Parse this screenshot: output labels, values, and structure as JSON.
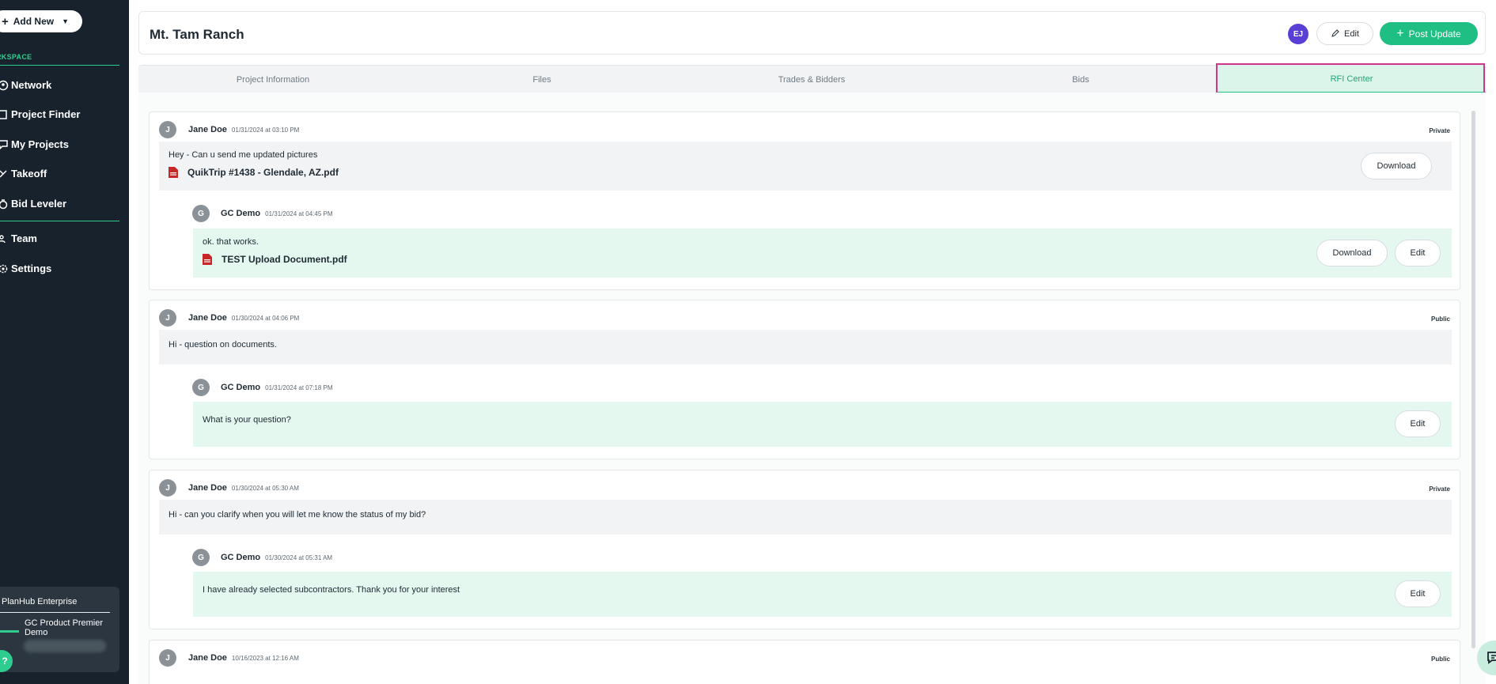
{
  "sidebar": {
    "add_new_label": "Add New",
    "workspace_label": "RKSPACE",
    "items": [
      {
        "label": "Network",
        "icon": "network-icon"
      },
      {
        "label": "Project Finder",
        "icon": "project-finder-icon"
      },
      {
        "label": "My Projects",
        "icon": "my-projects-icon"
      },
      {
        "label": "Takeoff",
        "icon": "takeoff-icon"
      },
      {
        "label": "Bid Leveler",
        "icon": "bid-leveler-icon"
      },
      {
        "label": "Team",
        "icon": "team-icon"
      },
      {
        "label": "Settings",
        "icon": "settings-icon"
      }
    ],
    "enterprise_title": "PlanHub Enterprise",
    "org_name": "GC Product Premier Demo"
  },
  "header": {
    "title": "Mt. Tam Ranch",
    "avatar_initials": "EJ",
    "edit_label": "Edit",
    "post_update_label": "Post Update"
  },
  "tabs": [
    {
      "label": "Project Information"
    },
    {
      "label": "Files"
    },
    {
      "label": "Trades & Bidders"
    },
    {
      "label": "Bids"
    },
    {
      "label": "RFI Center",
      "active": true
    }
  ],
  "threads": [
    {
      "avatar": "J",
      "author": "Jane Doe",
      "timestamp": "01/31/2024 at 03:10 PM",
      "privacy": "Private",
      "message": "Hey - Can u send me updated pictures",
      "file": "QuikTrip #1438 - Glendale, AZ.pdf",
      "download_label": "Download",
      "reply": {
        "avatar": "G",
        "author": "GC Demo",
        "timestamp": "01/31/2024 at 04:45 PM",
        "message": "ok. that works.",
        "file": "TEST Upload Document.pdf",
        "download_label": "Download",
        "edit_label": "Edit"
      }
    },
    {
      "avatar": "J",
      "author": "Jane Doe",
      "timestamp": "01/30/2024 at 04:06 PM",
      "privacy": "Public",
      "message": "Hi - question on documents.",
      "reply": {
        "avatar": "G",
        "author": "GC Demo",
        "timestamp": "01/31/2024 at 07:18 PM",
        "message": "What is your question?",
        "edit_label": "Edit"
      }
    },
    {
      "avatar": "J",
      "author": "Jane Doe",
      "timestamp": "01/30/2024 at 05:30 AM",
      "privacy": "Private",
      "message": "Hi - can you clarify when you will let me know the status of my bid?",
      "reply": {
        "avatar": "G",
        "author": "GC Demo",
        "timestamp": "01/30/2024 at 05:31 AM",
        "message": "I have already selected subcontractors. Thank you for your interest",
        "edit_label": "Edit"
      }
    },
    {
      "avatar": "J",
      "author": "Jane Doe",
      "timestamp": "10/16/2023 at 12:16 AM",
      "privacy": "Public"
    }
  ],
  "colors": {
    "sidebar_bg": "#17222c",
    "accent_green": "#1fbf84",
    "highlight_pink": "#cc3a87",
    "reply_bg": "#e4f8f0"
  }
}
